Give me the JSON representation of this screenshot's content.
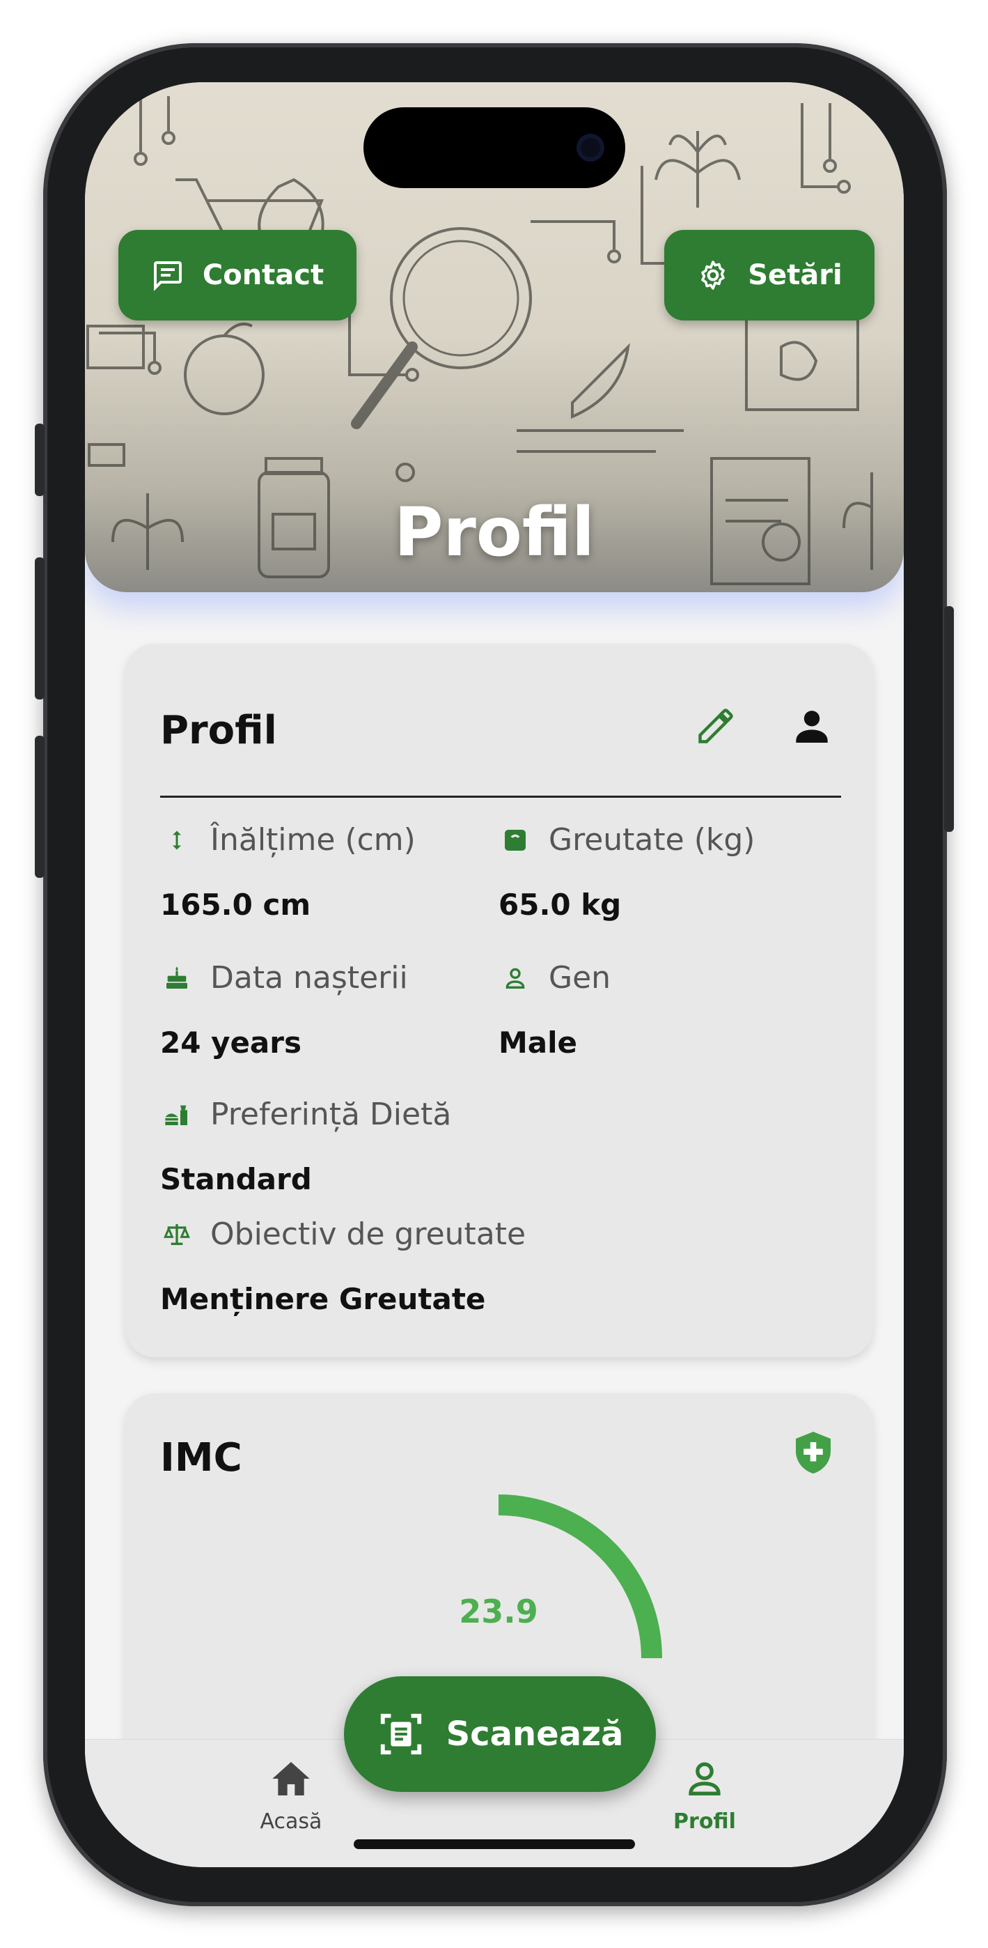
{
  "colors": {
    "accent": "#2e7d32",
    "accent_light": "#4caf50",
    "card_bg": "#e8e8e8",
    "screen_bg": "#f4f4f4"
  },
  "header": {
    "title": "Profil",
    "contact_label": "Contact",
    "settings_label": "Setări"
  },
  "profile_card": {
    "title": "Profil",
    "edit_icon": "pencil-icon",
    "person_icon": "person-icon",
    "fields": [
      {
        "icon": "height-arrows-icon",
        "label": "Înălțime (cm)",
        "value": "165.0 cm"
      },
      {
        "icon": "scale-icon",
        "label": "Greutate (kg)",
        "value": "65.0 kg"
      },
      {
        "icon": "cake-icon",
        "label": "Data nașterii",
        "value": "24 years"
      },
      {
        "icon": "person-outline-icon",
        "label": "Gen",
        "value": "Male"
      },
      {
        "icon": "food-icon",
        "label": "Preferință Dietă",
        "value": "Standard"
      },
      {
        "icon": "balance-icon",
        "label": "Obiectiv de greutate",
        "value": "Menținere Greutate"
      }
    ]
  },
  "imc_card": {
    "title": "IMC",
    "icon": "health-shield-icon",
    "value": "23.9"
  },
  "fab": {
    "label": "Scanează",
    "icon": "document-scan-icon"
  },
  "bottom_nav": {
    "items": [
      {
        "label": "Acasă",
        "icon": "home-icon",
        "active": false
      },
      {
        "label": "Profil",
        "icon": "person-outline-icon",
        "active": true
      }
    ]
  }
}
